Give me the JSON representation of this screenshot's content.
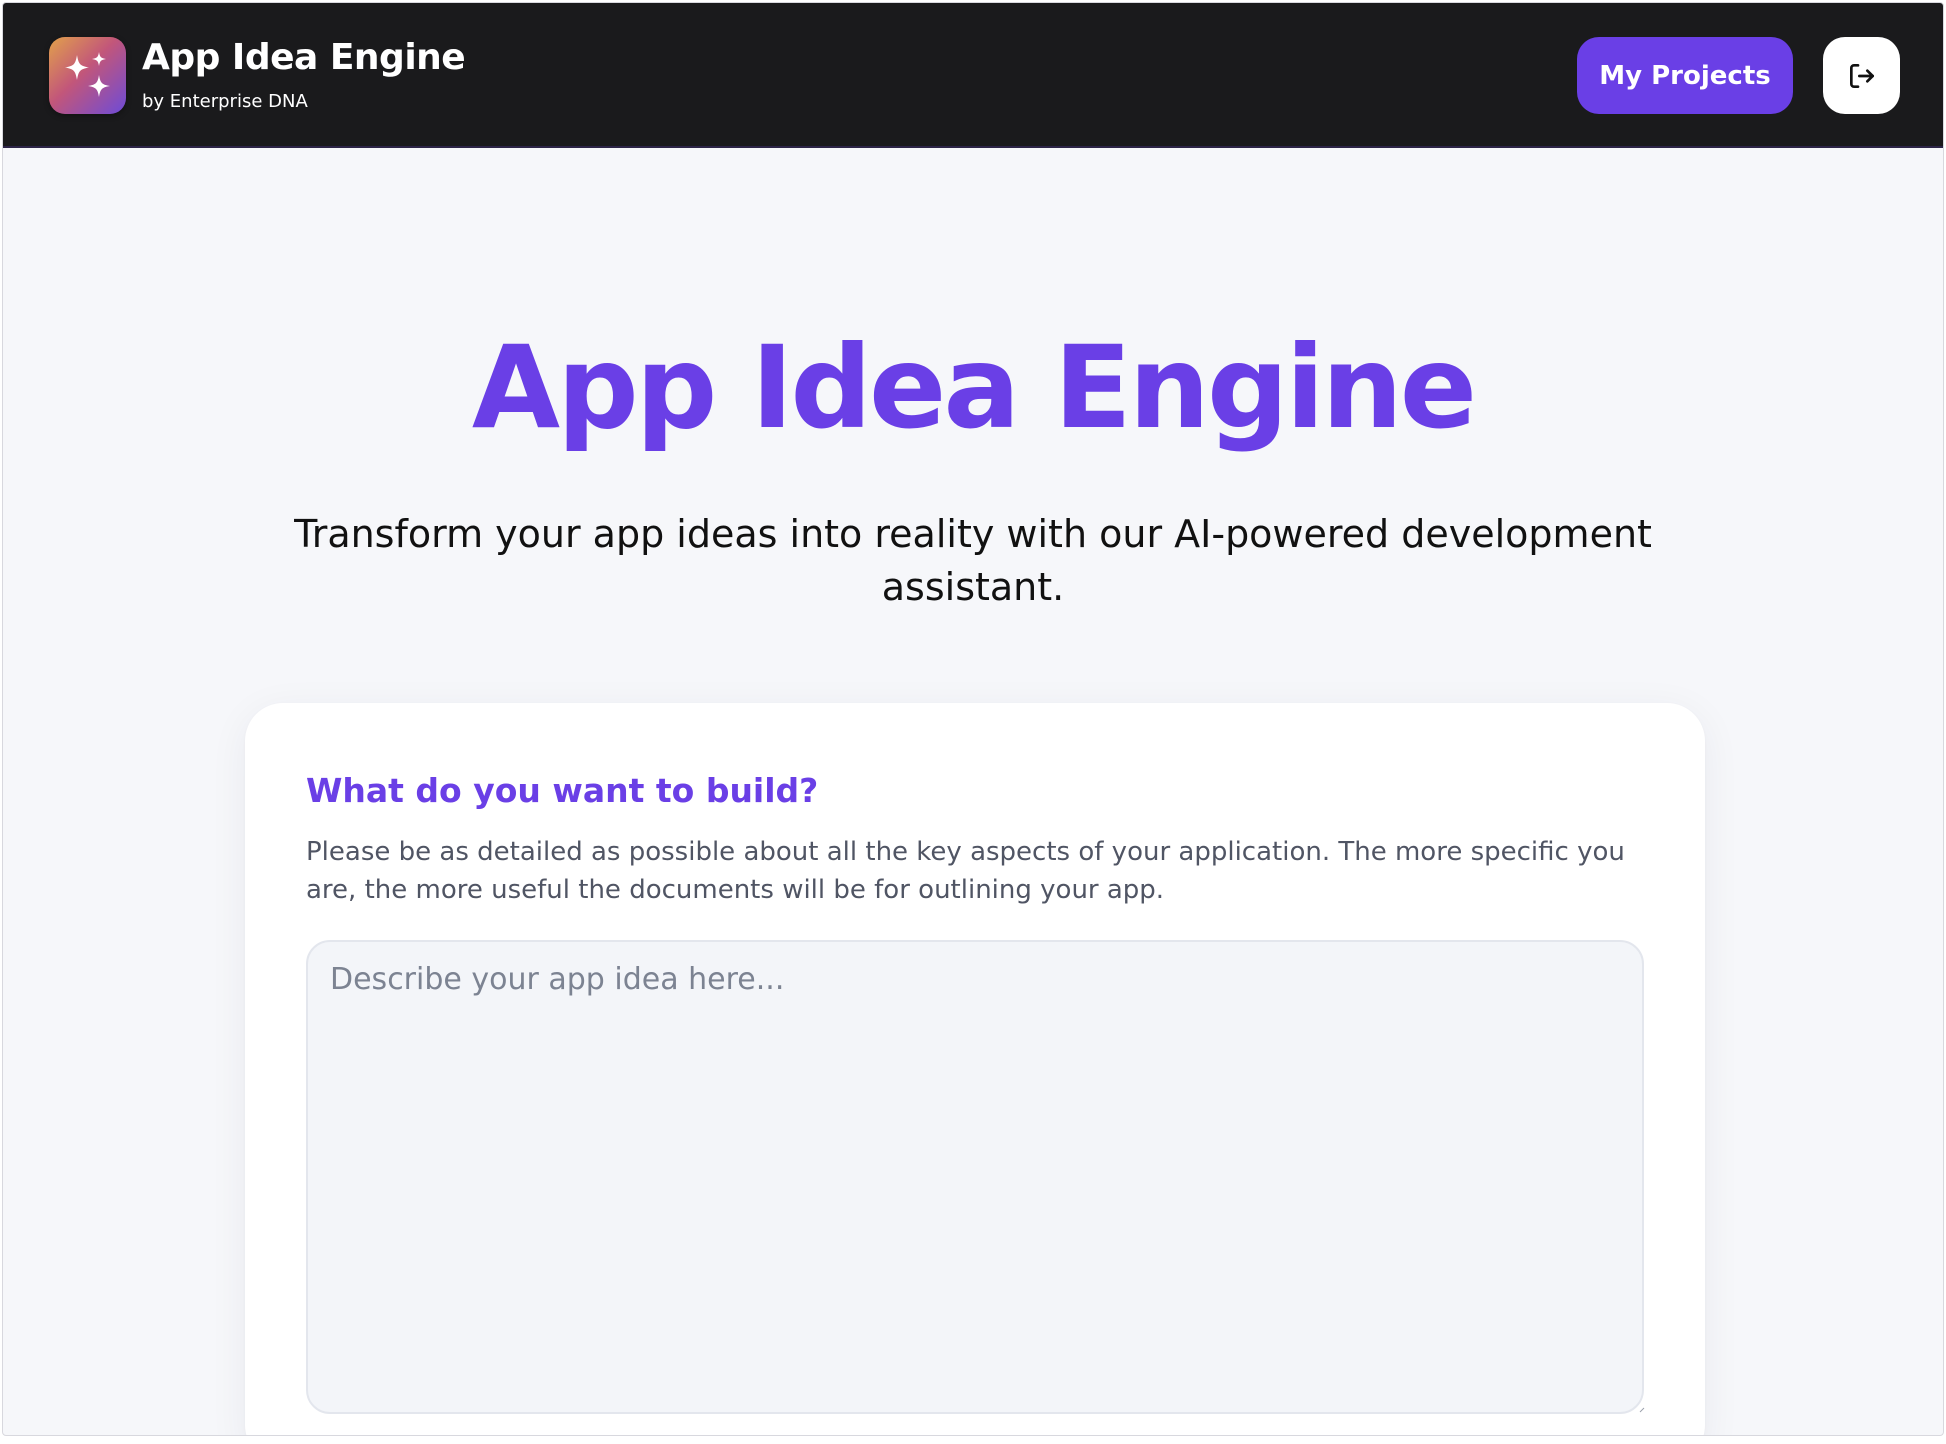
{
  "header": {
    "brand_title": "App Idea Engine",
    "brand_subtitle": "by Enterprise DNA",
    "logo_icon": "sparkles-icon",
    "my_projects_label": "My Projects",
    "logout_icon": "logout-icon"
  },
  "hero": {
    "title": "App Idea Engine",
    "subtitle": "Transform your app ideas into reality with our AI-powered development assistant."
  },
  "idea_card": {
    "title": "What do you want to build?",
    "description": "Please be as detailed as possible about all the key aspects of your application. The more specific you are, the more useful the documents will be for outlining your app.",
    "input_placeholder": "Describe your app idea here...",
    "input_value": ""
  },
  "colors": {
    "accent": "#6a3fe6",
    "header_bg": "#1a1a1c",
    "page_bg": "#f6f7fa",
    "input_bg": "#f3f5f9"
  }
}
